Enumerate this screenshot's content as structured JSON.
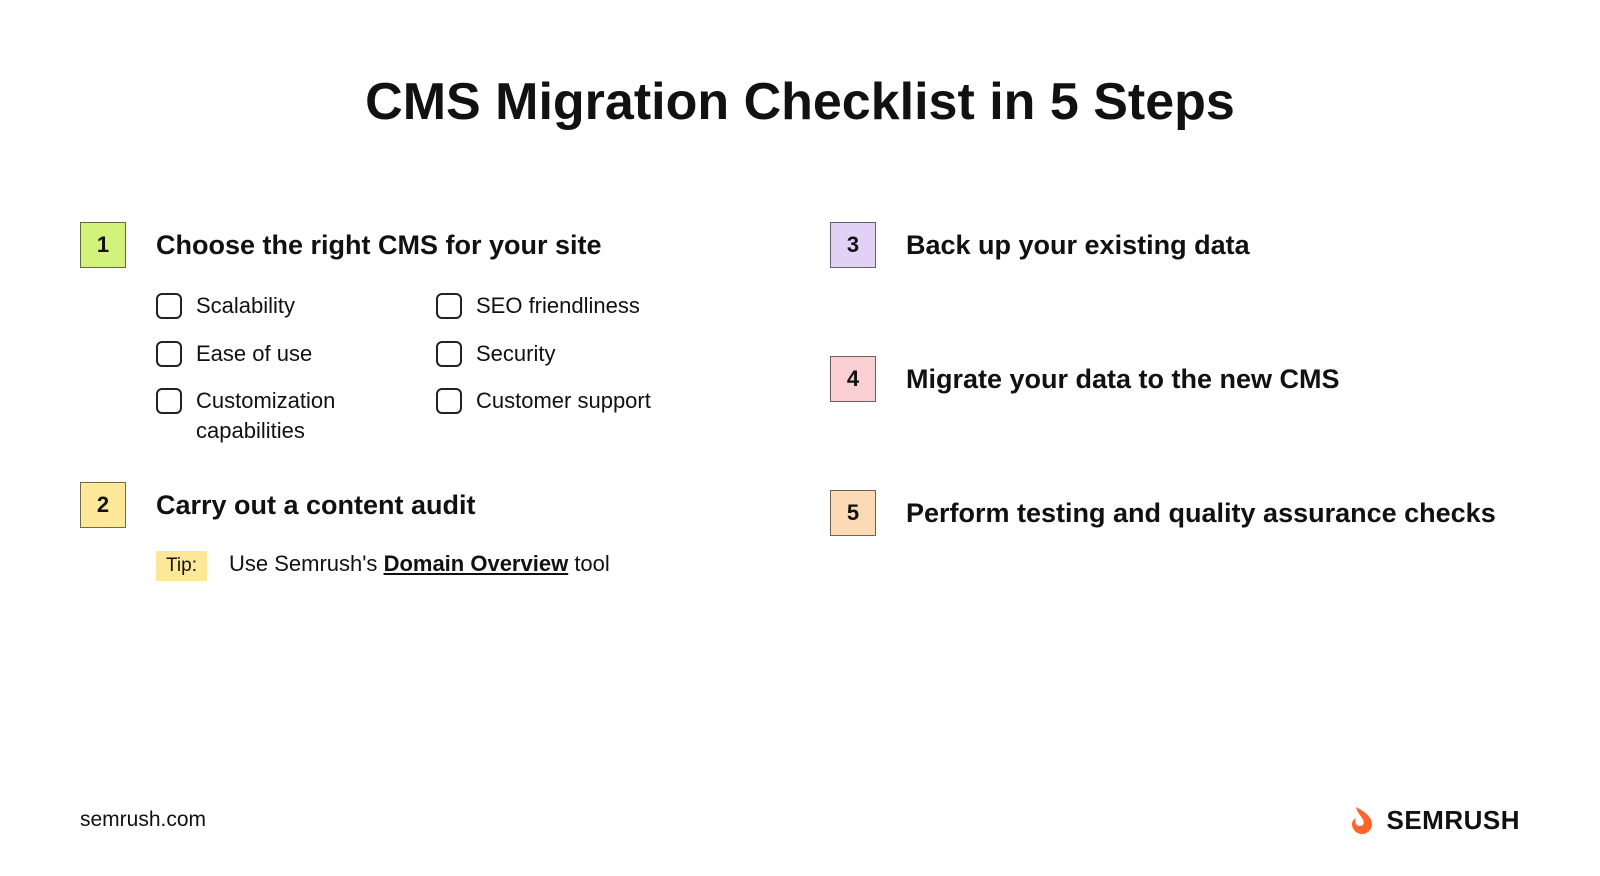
{
  "title": "CMS Migration Checklist in 5 Steps",
  "steps": [
    {
      "num": "1",
      "title": "Choose the right CMS for your site",
      "checks_left": [
        "Scalability",
        "Ease of use",
        "Customization capabilities"
      ],
      "checks_right": [
        "SEO friendliness",
        "Security",
        "Customer support"
      ]
    },
    {
      "num": "2",
      "title": "Carry out a content audit",
      "tip_label": "Tip:",
      "tip_prefix": "Use Semrush's ",
      "tip_link": "Domain Overview",
      "tip_suffix": " tool"
    },
    {
      "num": "3",
      "title": "Back up your existing data"
    },
    {
      "num": "4",
      "title": "Migrate your data to the new CMS"
    },
    {
      "num": "5",
      "title": "Perform testing and quality assurance checks"
    }
  ],
  "footer": {
    "url": "semrush.com",
    "brand": "SEMRUSH"
  }
}
